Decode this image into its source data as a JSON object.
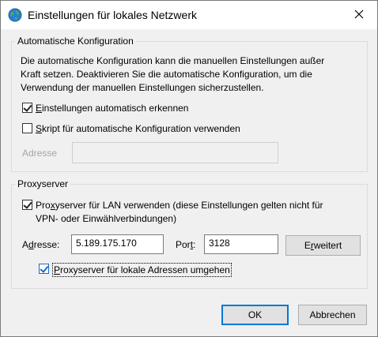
{
  "window": {
    "title": "Einstellungen für lokales Netzwerk",
    "icon": "globe-network-icon",
    "close_glyph": "✕"
  },
  "auto_config": {
    "legend": "Automatische Konfiguration",
    "description_lines": [
      "Die automatische Konfiguration kann die manuellen Einstellungen außer",
      "Kraft setzen. Deaktivieren Sie die automatische Konfiguration, um die",
      "Verwendung der manuellen Einstellungen sicherzustellen."
    ],
    "detect_checkbox": {
      "checked": true,
      "label_access": "E",
      "label_rest": "instellungen automatisch erkennen"
    },
    "script_checkbox": {
      "checked": false,
      "label_access": "S",
      "label_rest": "kript für automatische Konfiguration verwenden"
    },
    "address_label": "Adresse",
    "address_value": ""
  },
  "proxy": {
    "legend": "Proxyserver",
    "use_proxy_checkbox": {
      "checked": true,
      "label_pre": "Pro",
      "label_access": "x",
      "label_line1_rest": "yserver für LAN verwenden (diese Einstellungen gelten nicht für",
      "label_line2": "VPN- oder Einwählverbindungen)"
    },
    "address_label_access": "d",
    "address_label_pre": "A",
    "address_label_rest": "resse:",
    "address_value": "5.189.175.170",
    "port_label_pre": "Por",
    "port_label_access": "t",
    "port_label_rest": ":",
    "port_value": "3128",
    "advanced_pre": "E",
    "advanced_access": "r",
    "advanced_rest": "weitert",
    "bypass_checkbox": {
      "checked": true,
      "label_access": "P",
      "label_rest": "roxyserver für lokale Adressen umgehen"
    }
  },
  "buttons": {
    "ok": "OK",
    "cancel": "Abbrechen"
  },
  "colors": {
    "accent": "#0078d7",
    "checkbox_focus": "#1c69c8"
  }
}
